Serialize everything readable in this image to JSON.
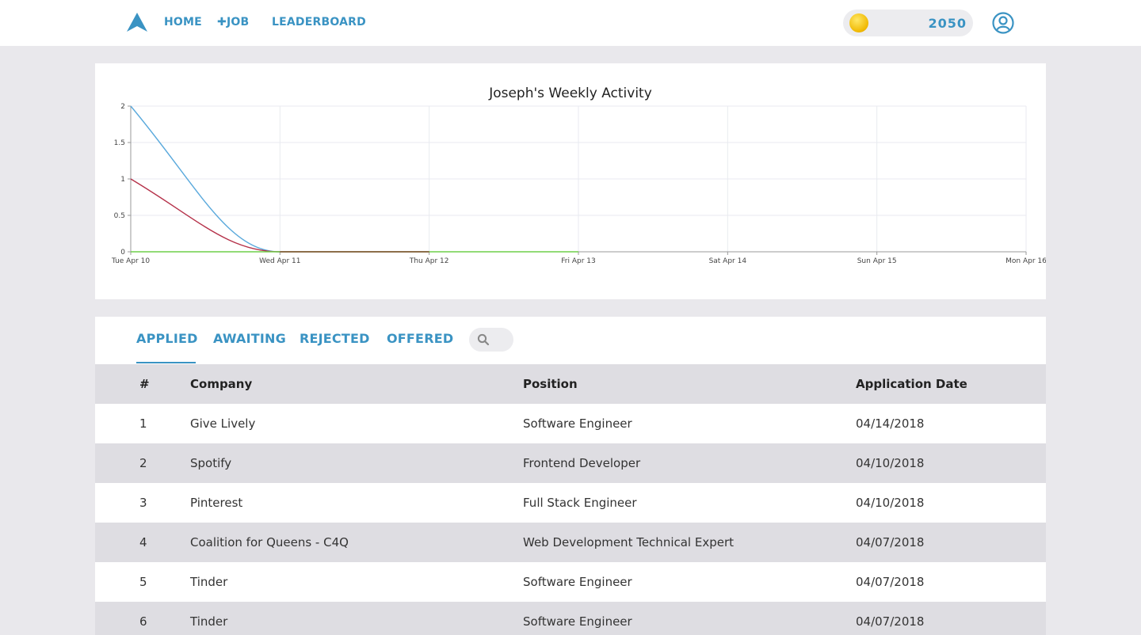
{
  "nav": {
    "home": "HOME",
    "add_job": "JOB",
    "leaderboard": "LEADERBOARD",
    "coins": "2050"
  },
  "colors": {
    "accent": "#3a93c3",
    "series_blue": "#5aa9dc",
    "series_red": "#b5324a",
    "series_green": "#6fcf4a",
    "series_brown": "#8b5a3c"
  },
  "chart_data": {
    "type": "line",
    "title": "Joseph's Weekly Activity",
    "x": [
      "Tue Apr 10",
      "Wed Apr 11",
      "Thu Apr 12",
      "Fri Apr 13",
      "Sat Apr 14",
      "Sun Apr 15",
      "Mon Apr 16"
    ],
    "ylim": [
      0,
      2
    ],
    "yticks": [
      "0",
      "0.5",
      "1",
      "1.5",
      "2"
    ],
    "grid": true,
    "series": [
      {
        "color": "#5aa9dc",
        "values": [
          2,
          0,
          0,
          null,
          null,
          null,
          null
        ]
      },
      {
        "color": "#b5324a",
        "values": [
          1,
          0,
          0,
          null,
          null,
          null,
          null
        ]
      },
      {
        "color": "#6fcf4a",
        "values": [
          0,
          0,
          0,
          0,
          null,
          null,
          null
        ]
      },
      {
        "color": "#8b5a3c",
        "values": [
          null,
          0,
          0,
          null,
          null,
          null,
          null
        ]
      }
    ]
  },
  "tabs": [
    {
      "label": "APPLIED",
      "active": true
    },
    {
      "label": "AWAITING",
      "active": false
    },
    {
      "label": "REJECTED",
      "active": false
    },
    {
      "label": "OFFERED",
      "active": false
    }
  ],
  "table": {
    "headers": [
      "#",
      "Company",
      "Position",
      "Application Date"
    ],
    "rows": [
      [
        "1",
        "Give Lively",
        "Software Engineer",
        "04/14/2018"
      ],
      [
        "2",
        "Spotify",
        "Frontend Developer",
        "04/10/2018"
      ],
      [
        "3",
        "Pinterest",
        "Full Stack Engineer",
        "04/10/2018"
      ],
      [
        "4",
        "Coalition for Queens - C4Q",
        "Web Development Technical Expert",
        "04/07/2018"
      ],
      [
        "5",
        "Tinder",
        "Software Engineer",
        "04/07/2018"
      ],
      [
        "6",
        "Tinder",
        "Software Engineer",
        "04/07/2018"
      ]
    ]
  }
}
